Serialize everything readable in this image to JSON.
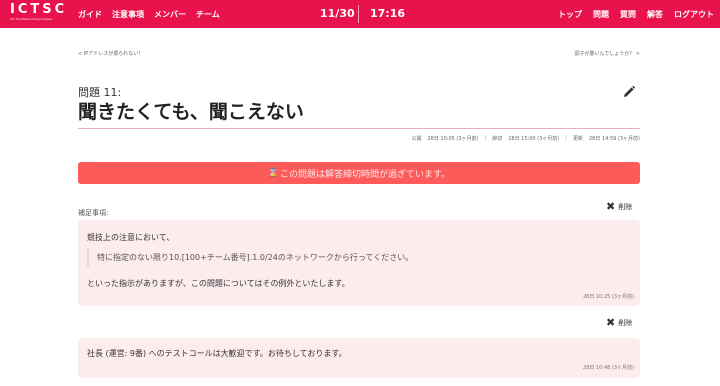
{
  "header": {
    "logo": "ICTSC",
    "logo_sub": "ICT Troubleshooting Contest",
    "nav_left": [
      "ガイド",
      "注意事項",
      "メンバー",
      "チーム"
    ],
    "date": "11/30",
    "time": "17:16",
    "nav_right": [
      "トップ",
      "問題",
      "質問",
      "解答",
      "ログアウト"
    ],
    "colors": {
      "brand": "#e8124d",
      "alert": "#fd5a5a",
      "card": "#fcecee"
    }
  },
  "prevnext": {
    "prev": "< IPアドレスが振られない！",
    "next": "調子が悪いんでしょうか？ >"
  },
  "problem": {
    "number": "問題 11:",
    "title": "聞きたくても、聞こえない",
    "edit_icon": "pencil-icon"
  },
  "meta": {
    "published_label": "公開",
    "published_value": "28日 10:05 (3ヶ月前)",
    "deadline_label": "締切",
    "deadline_value": "28日 15:00 (3ヶ月前)",
    "updated_label": "更新",
    "updated_value": "28日 14:59 (3ヶ月前)",
    "separator": "|"
  },
  "alert": {
    "icon": "hourglass-icon",
    "glyph": "⌛",
    "text": "この問題は解答締切時間が過ぎています。"
  },
  "supplement": {
    "label": "補足事項:",
    "delete_label": "削除",
    "delete_icon": "✖",
    "notes": [
      {
        "line1": "競技上の注意において、",
        "quote": "特に指定のない限り10.[100+チーム番号].1.0/24のネットワークから行ってください。",
        "line2": "といった指示がありますが、この問題についてはその例外といたします。",
        "timestamp": "28日 10:25 (3ヶ月前)"
      },
      {
        "line1": "社長 (運営: 9番) へのテストコールは大歓迎です。お待ちしております。",
        "timestamp": "28日 10:48 (3ヶ月前)"
      }
    ]
  }
}
